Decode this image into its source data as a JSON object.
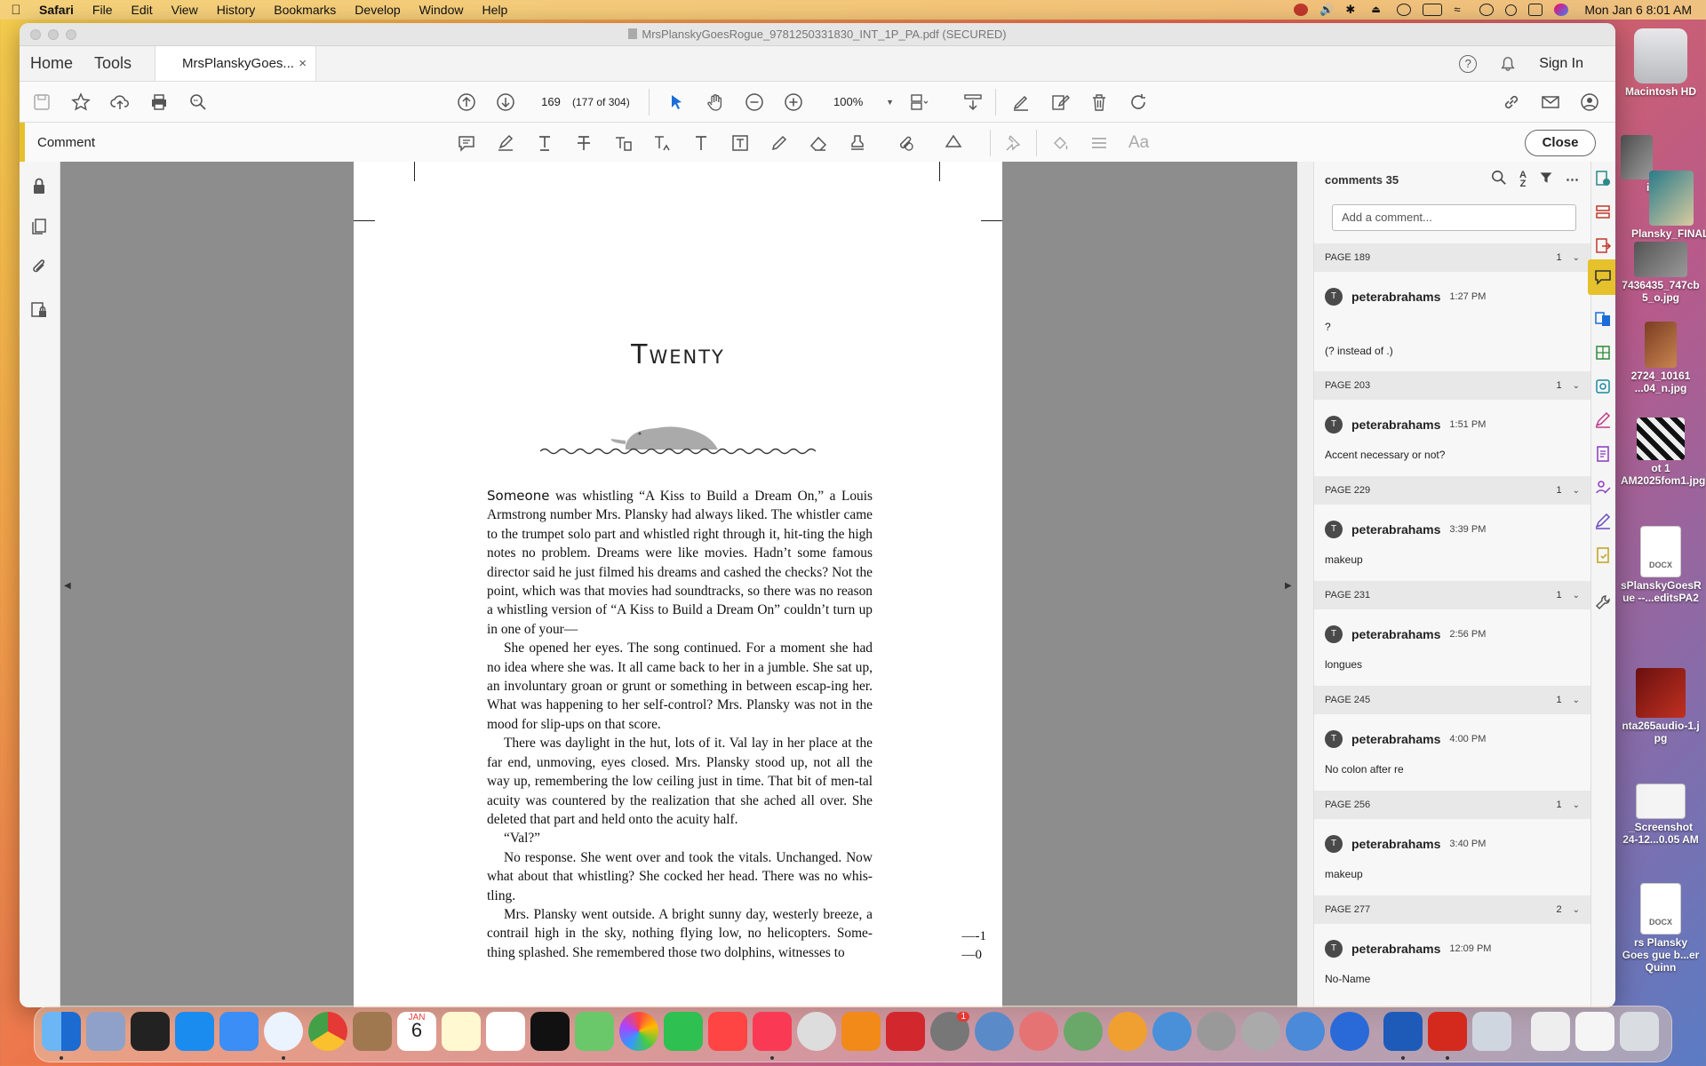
{
  "menubar": {
    "app": "Safari",
    "items": [
      "File",
      "Edit",
      "View",
      "History",
      "Bookmarks",
      "Develop",
      "Window",
      "Help"
    ],
    "clock": "Mon Jan 6  8:01 AM"
  },
  "window": {
    "title": "MrsPlanskyGoesRogue_9781250331830_INT_1P_PA.pdf (SECURED)",
    "tabs": {
      "home": "Home",
      "tools": "Tools",
      "doc": "MrsPlanskyGoes...",
      "close": "×"
    },
    "signin": "Sign In",
    "help_icon": "?"
  },
  "toolbar": {
    "page_number": "169",
    "page_count": "(177 of 304)",
    "zoom": "100%"
  },
  "commentbar": {
    "label": "Comment",
    "close": "Close",
    "aa": "Aa"
  },
  "document": {
    "chapter": "Twenty",
    "lead": "Someone",
    "paragraphs": [
      " was whistling “A Kiss to Build a Dream On,” a Louis Armstrong number Mrs. Plansky had always liked. The whistler came to the trumpet solo part and whistled right through it, hit-ting the high notes no problem. Dreams were like movies. Hadn’t some famous director said he just filmed his dreams and cashed the checks? Not the point, which was that movies had soundtracks, so there was no reason a whistling version of “A Kiss to Build a Dream On” couldn’t turn up in one of your—",
      "She opened her eyes. The song continued. For a moment she had no idea where she was. It all came back to her in a jumble. She sat up, an involuntary groan or grunt or something in between escap-ing her. What was happening to her self-control? Mrs. Plansky was not in the mood for slip-ups on that score.",
      "There was daylight in the hut, lots of it. Val lay in her place at the far end, unmoving, eyes closed. Mrs. Plansky stood up, not all the way up, remembering the low ceiling just in time. That bit of men-tal acuity was countered by the realization that she ached all over. She deleted that part and held onto the acuity half.",
      "“Val?”",
      "No response. She went over and took the vitals. Unchanged. Now what about that whistling? She cocked her head. There was no whis-tling.",
      "Mrs. Plansky went outside. A bright sunny day, westerly breeze, a contrail high in the sky, nothing flying low, no helicopters. Some-thing splashed. She remembered those two dolphins, witnesses to"
    ],
    "folio_1": "—-1",
    "folio_0": "—0"
  },
  "comments": {
    "header": "comments 35",
    "add_placeholder": "Add a comment...",
    "groups": [
      {
        "page": "PAGE 189",
        "count": "1",
        "user": "peterabrahams",
        "time": "1:27 PM",
        "text": "?",
        "text2": "(? instead of .)"
      },
      {
        "page": "PAGE 203",
        "count": "1",
        "user": "peterabrahams",
        "time": "1:51 PM",
        "text": "Accent necessary or not?",
        "text2": ""
      },
      {
        "page": "PAGE 229",
        "count": "1",
        "user": "peterabrahams",
        "time": "3:39 PM",
        "text": "makeup",
        "text2": ""
      },
      {
        "page": "PAGE 231",
        "count": "1",
        "user": "peterabrahams",
        "time": "2:56 PM",
        "text": "longues",
        "text2": ""
      },
      {
        "page": "PAGE 245",
        "count": "1",
        "user": "peterabrahams",
        "time": "4:00 PM",
        "text": "No colon after re",
        "text2": ""
      },
      {
        "page": "PAGE 256",
        "count": "1",
        "user": "peterabrahams",
        "time": "3:40 PM",
        "text": "makeup",
        "text2": ""
      },
      {
        "page": "PAGE 277",
        "count": "2",
        "user": "peterabrahams",
        "time": "12:09 PM",
        "text": "No-Name",
        "text2": ""
      }
    ]
  },
  "desktop": {
    "items": [
      "Macintosh HD",
      "io.jpg",
      "Plansky_FINAL_1 pg",
      "7436435_747cb 5_o.jpg",
      "2724_10161 ...04_n.jpg",
      "ot 1 AM2025fom1.jpg",
      "sPlanskyGoesR ue --...editsPA2",
      "nta265audio-1.j pg",
      "_Screenshot 24-12...0.05 AM",
      "rs Plansky Goes gue b...er Quinn"
    ],
    "docx": "DOCX"
  },
  "dock": {
    "calendar_month": "JAN",
    "calendar_day": "6",
    "badge": "1"
  }
}
